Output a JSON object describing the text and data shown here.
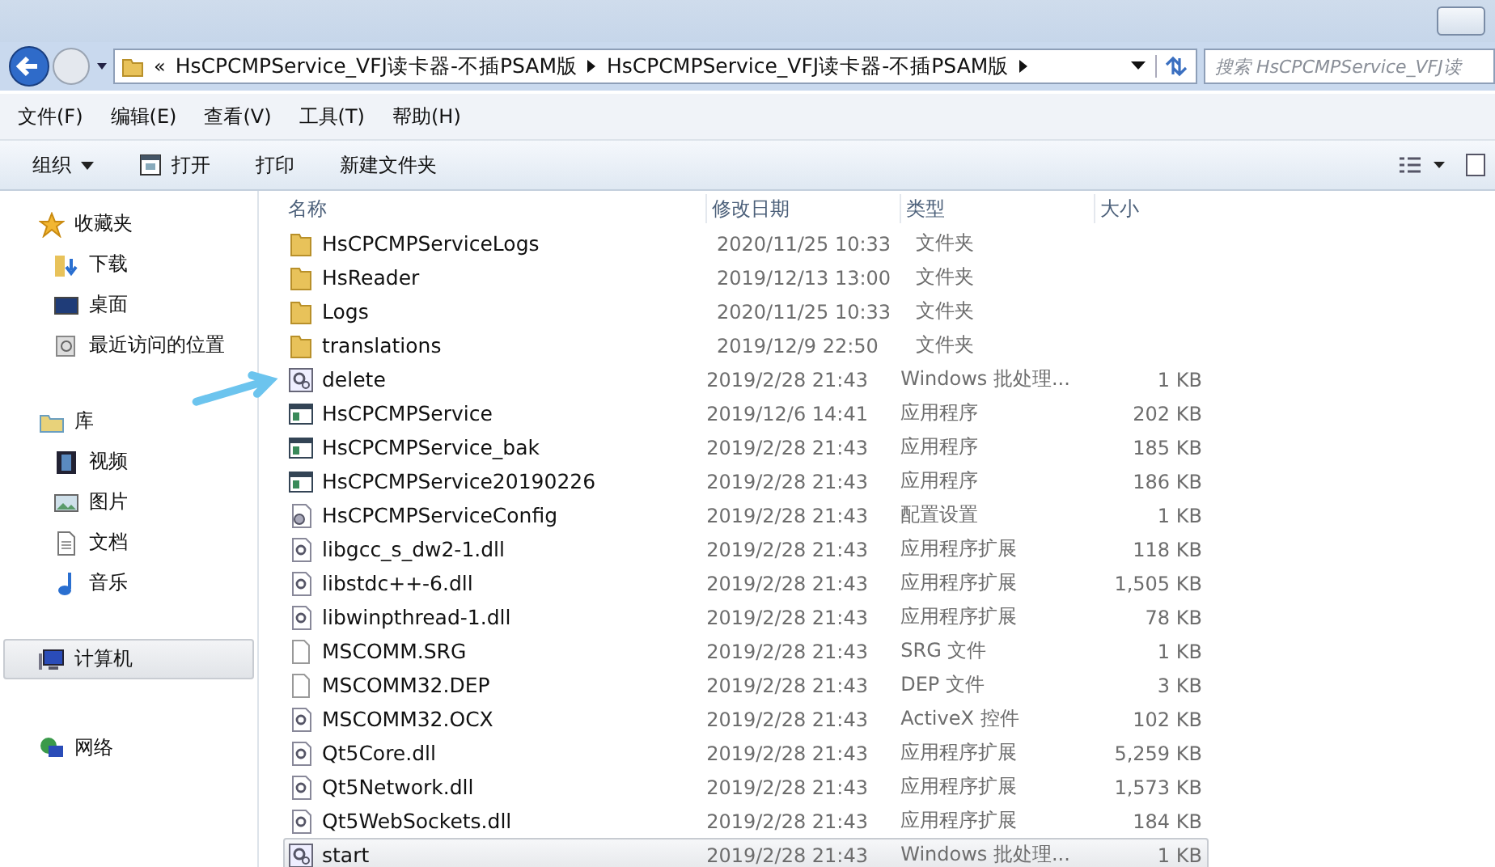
{
  "address": {
    "overflow": "«",
    "crumbs": [
      "HsCPCMPService_VFJ读卡器-不插PSAM版",
      "HsCPCMPService_VFJ读卡器-不插PSAM版"
    ]
  },
  "search": {
    "placeholder": "搜索 HsCPCMPService_VFJ读"
  },
  "menu": [
    "文件(F)",
    "编辑(E)",
    "查看(V)",
    "工具(T)",
    "帮助(H)"
  ],
  "toolbar": [
    {
      "label": "组织",
      "kind": "dropdown"
    },
    {
      "label": "打开",
      "kind": "open"
    },
    {
      "label": "打印",
      "kind": "plain"
    },
    {
      "label": "新建文件夹",
      "kind": "plain"
    }
  ],
  "sidebar": [
    {
      "label": "收藏夹",
      "kind": "star",
      "selected": false,
      "children": [
        {
          "label": "下载",
          "kind": "download",
          "selected": false
        },
        {
          "label": "桌面",
          "kind": "desktop",
          "selected": false
        },
        {
          "label": "最近访问的位置",
          "kind": "recent",
          "selected": false
        }
      ]
    },
    {
      "label": "库",
      "kind": "library",
      "selected": false,
      "children": [
        {
          "label": "视频",
          "kind": "video",
          "selected": false
        },
        {
          "label": "图片",
          "kind": "picture",
          "selected": false
        },
        {
          "label": "文档",
          "kind": "document",
          "selected": false
        },
        {
          "label": "音乐",
          "kind": "music",
          "selected": false
        }
      ]
    },
    {
      "label": "计算机",
      "kind": "computer",
      "selected": true
    },
    {
      "label": "网络",
      "kind": "network",
      "selected": false
    }
  ],
  "columns": [
    "名称",
    "修改日期",
    "类型",
    "大小"
  ],
  "rows": [
    {
      "name": "HsCPCMPServiceLogs",
      "date": "2020/11/25 10:33",
      "type": "文件夹",
      "kind": "folder",
      "selected": false
    },
    {
      "name": "HsReader",
      "date": "2019/12/13 13:00",
      "type": "文件夹",
      "kind": "folder",
      "selected": false
    },
    {
      "name": "Logs",
      "date": "2020/11/25 10:33",
      "type": "文件夹",
      "kind": "folder",
      "selected": false
    },
    {
      "name": "translations",
      "date": "2019/12/9 22:50",
      "type": "文件夹",
      "kind": "folder",
      "selected": false
    },
    {
      "name": "delete",
      "date": "2019/2/28 21:43",
      "type": "Windows 批处理...",
      "size": "1 KB",
      "kind": "batch",
      "selected": false
    },
    {
      "name": "HsCPCMPService",
      "date": "2019/12/6 14:41",
      "type": "应用程序",
      "size": "202 KB",
      "kind": "exe",
      "selected": false
    },
    {
      "name": "HsCPCMPService_bak",
      "date": "2019/2/28 21:43",
      "type": "应用程序",
      "size": "185 KB",
      "kind": "exe",
      "selected": false
    },
    {
      "name": "HsCPCMPService20190226",
      "date": "2019/2/28 21:43",
      "type": "应用程序",
      "size": "186 KB",
      "kind": "exe",
      "selected": false
    },
    {
      "name": "HsCPCMPServiceConfig",
      "date": "2019/2/28 21:43",
      "type": "配置设置",
      "size": "1 KB",
      "kind": "config",
      "selected": false
    },
    {
      "name": "libgcc_s_dw2-1.dll",
      "date": "2019/2/28 21:43",
      "type": "应用程序扩展",
      "size": "118 KB",
      "kind": "dll",
      "selected": false
    },
    {
      "name": "libstdc++-6.dll",
      "date": "2019/2/28 21:43",
      "type": "应用程序扩展",
      "size": "1,505 KB",
      "kind": "dll",
      "selected": false
    },
    {
      "name": "libwinpthread-1.dll",
      "date": "2019/2/28 21:43",
      "type": "应用程序扩展",
      "size": "78 KB",
      "kind": "dll",
      "selected": false
    },
    {
      "name": "MSCOMM.SRG",
      "date": "2019/2/28 21:43",
      "type": "SRG 文件",
      "size": "1 KB",
      "kind": "file",
      "selected": false
    },
    {
      "name": "MSCOMM32.DEP",
      "date": "2019/2/28 21:43",
      "type": "DEP 文件",
      "size": "3 KB",
      "kind": "file",
      "selected": false
    },
    {
      "name": "MSCOMM32.OCX",
      "date": "2019/2/28 21:43",
      "type": "ActiveX 控件",
      "size": "102 KB",
      "kind": "dll",
      "selected": false
    },
    {
      "name": "Qt5Core.dll",
      "date": "2019/2/28 21:43",
      "type": "应用程序扩展",
      "size": "5,259 KB",
      "kind": "dll",
      "selected": false
    },
    {
      "name": "Qt5Network.dll",
      "date": "2019/2/28 21:43",
      "type": "应用程序扩展",
      "size": "1,573 KB",
      "kind": "dll",
      "selected": false
    },
    {
      "name": "Qt5WebSockets.dll",
      "date": "2019/2/28 21:43",
      "type": "应用程序扩展",
      "size": "184 KB",
      "kind": "dll",
      "selected": false
    },
    {
      "name": "start",
      "date": "2019/2/28 21:43",
      "type": "Windows 批处理...",
      "size": "1 KB",
      "kind": "batch",
      "selected": true
    }
  ]
}
